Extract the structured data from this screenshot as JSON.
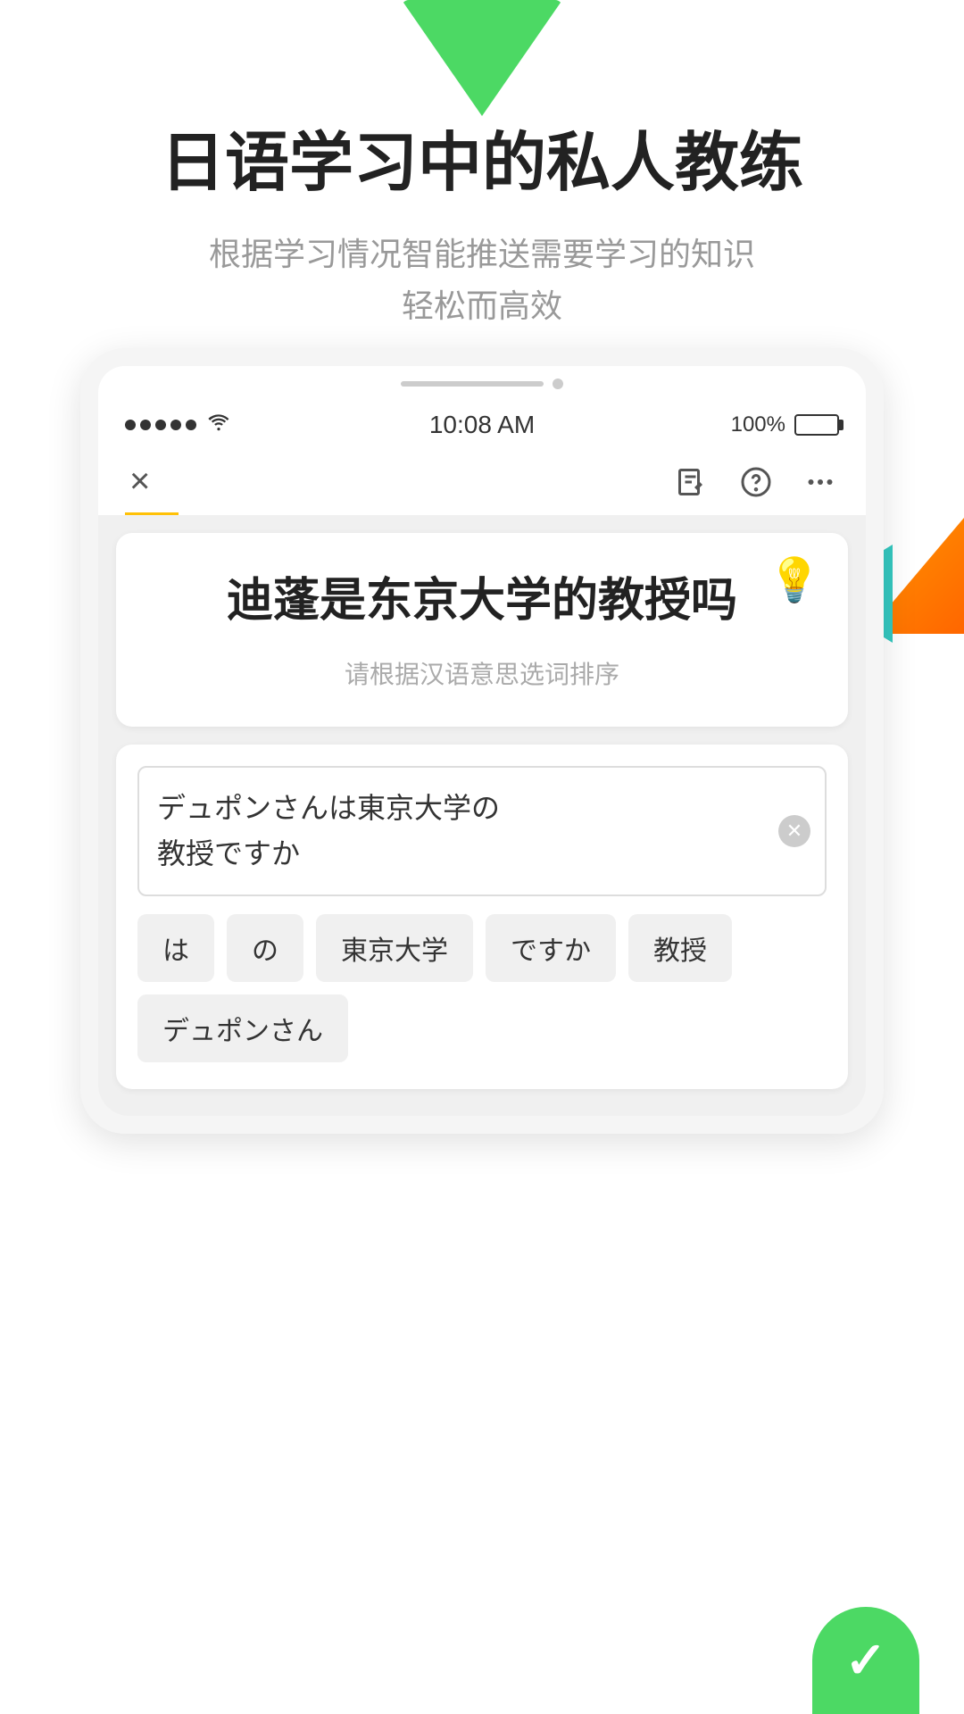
{
  "decorations": {
    "top_triangle_color": "#4CD964",
    "right_deco_orange": "#FF9500",
    "right_deco_teal": "#34C8C0",
    "bottom_circle_color": "#4CD964"
  },
  "header": {
    "main_title": "日语学习中的私人教练",
    "sub_title_line1": "根据学习情况智能推送需要学习的知识",
    "sub_title_line2": "轻松而高效"
  },
  "phone": {
    "status_bar": {
      "time": "10:08 AM",
      "battery": "100%"
    },
    "nav": {
      "close_label": "×"
    },
    "question_card": {
      "hint_icon": "💡",
      "question": "迪蓬是东京大学的教授吗",
      "hint_text": "请根据汉语意思选词排序"
    },
    "answer_card": {
      "answer_text_line1": "デュポンさんは東京大学の",
      "answer_text_line2": "教授ですか",
      "word_chips": [
        {
          "id": 1,
          "label": "は"
        },
        {
          "id": 2,
          "label": "の"
        },
        {
          "id": 3,
          "label": "東京大学"
        },
        {
          "id": 4,
          "label": "ですか"
        },
        {
          "id": 5,
          "label": "教授"
        },
        {
          "id": 6,
          "label": "デュポンさん"
        }
      ]
    }
  }
}
